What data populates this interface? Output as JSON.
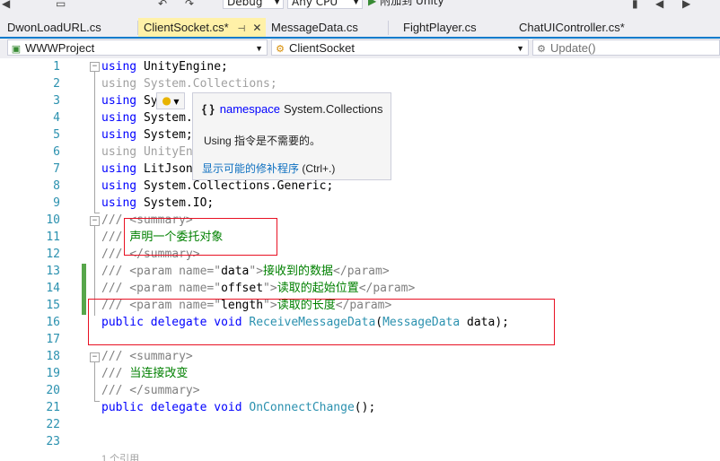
{
  "toolbar": {
    "config": "Debug",
    "platform": "Any CPU",
    "attach_label": "附加到 Unity"
  },
  "tabs": [
    {
      "label": "DwonLoadURL.cs",
      "active": false
    },
    {
      "label": "ClientSocket.cs*",
      "active": true
    },
    {
      "label": "MessageData.cs",
      "active": false
    },
    {
      "label": "FightPlayer.cs",
      "active": false
    },
    {
      "label": "ChatUIController.cs*",
      "active": false
    }
  ],
  "nav": {
    "project": "WWWProject",
    "class": "ClientSocket",
    "member": "Update()"
  },
  "quick_info": {
    "kind": "namespace",
    "name": "System.Collections",
    "message": "Using 指令是不需要的。",
    "link_text": "显示可能的修补程序",
    "shortcut": "(Ctrl+.)"
  },
  "colors": {
    "keyword": "#0000ff",
    "type": "#2b91af",
    "comment": "#008000",
    "doc_tag": "#808080",
    "highlight_box": "#e81123"
  },
  "lines": {
    "n1": "1",
    "n2": "2",
    "n3": "3",
    "n4": "4",
    "n5": "5",
    "n6": "6",
    "n7": "7",
    "n8": "8",
    "n9": "9",
    "n10": "10",
    "n11": "11",
    "n12": "12",
    "n13": "13",
    "n14": "14",
    "n15": "15",
    "n16": "16",
    "n17": "17",
    "n18": "18",
    "n19": "19",
    "n20": "20",
    "n21": "21",
    "n22": "22",
    "n23": "23",
    "l1_ns": "UnityEngine;",
    "l2_ns": "System.Collections;",
    "l3_ns": "Sy",
    "l4_ns": "System.",
    "l5_ns": "System;",
    "l6_ns": "UnityEn",
    "l7_ns": "LitJson",
    "l8_ns": "System.Collections.Generic;",
    "l9_ns": "System.IO;",
    "l11_text": "声明一个委托对象",
    "l13_name": "data",
    "l13_text": "接收到的数据",
    "l14_name": "offset",
    "l14_text": "读取的起始位置",
    "l15_name": "length",
    "l15_text": "读取的长度",
    "l16_delegate": "ReceiveMessageData",
    "l16_ptype": "MessageData",
    "l16_pname": "data",
    "l19_text": "当连接改变",
    "l21_delegate": "OnConnectChange",
    "l24_refs": "1 个引用"
  }
}
